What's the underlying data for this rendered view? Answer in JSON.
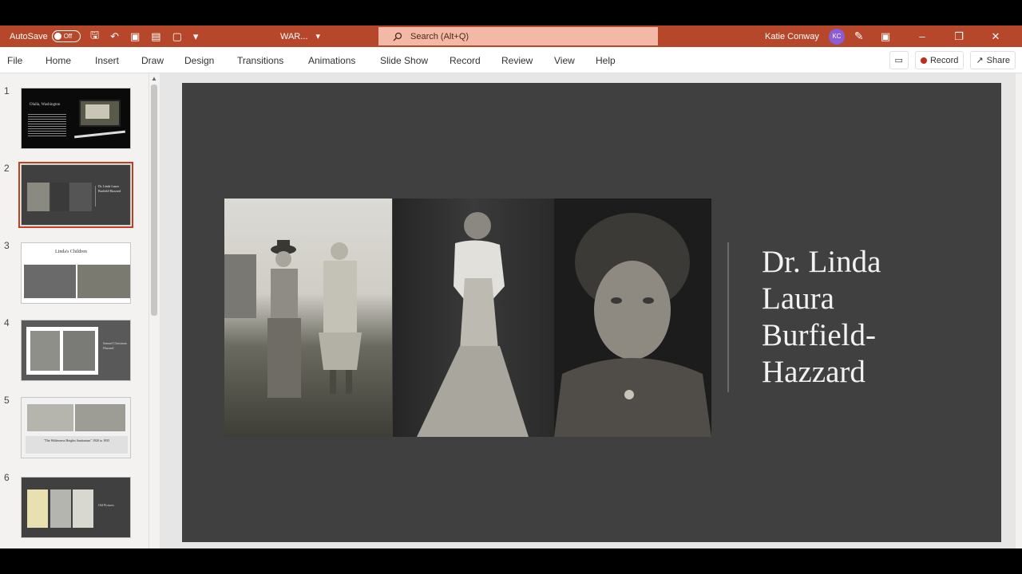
{
  "titlebar": {
    "autosave_label": "AutoSave",
    "autosave_state": "Off",
    "document_name": "WAR...",
    "search_placeholder": "Search (Alt+Q)",
    "user_name": "Katie Conway",
    "user_initials": "KC"
  },
  "ribbon": {
    "tabs": [
      "File",
      "Home",
      "Insert",
      "Draw",
      "Design",
      "Transitions",
      "Animations",
      "Slide Show",
      "Record",
      "Review",
      "View",
      "Help"
    ],
    "record_label": "Record",
    "share_label": "Share"
  },
  "thumbnails": [
    {
      "number": "1",
      "title": "Olalla, Washington"
    },
    {
      "number": "2",
      "title": "Dr. Linda Laura Burfield-Hazzard",
      "selected": true
    },
    {
      "number": "3",
      "title": "Linda's Children"
    },
    {
      "number": "4",
      "title": "Samuel Christman Hazzard"
    },
    {
      "number": "5",
      "title": "\"The Wilderness Heights Sanitarium\" 1920 to 1935"
    },
    {
      "number": "6",
      "title": "Old Pictures"
    }
  ],
  "slide": {
    "title_lines": [
      "Dr. Linda",
      "Laura",
      "Burfield-",
      "Hazzard"
    ],
    "background": "#404040"
  },
  "colors": {
    "accent": "#b7472a",
    "search_bg": "#f4b8a6",
    "avatar": "#8a5cd6"
  }
}
